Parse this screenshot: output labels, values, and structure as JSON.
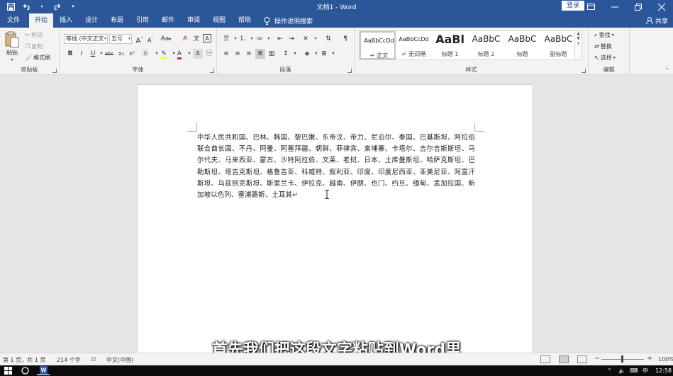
{
  "titlebar": {
    "title": "文档1 - Word",
    "login": "登录",
    "qat_icons": [
      "save-icon",
      "undo-icon",
      "redo-icon",
      "customize-qat-icon"
    ],
    "window_icons": [
      "ribbon-display-icon",
      "minimize-icon",
      "restore-icon",
      "close-icon"
    ]
  },
  "tabs": [
    "文件",
    "开始",
    "插入",
    "设计",
    "布局",
    "引用",
    "邮件",
    "审阅",
    "视图",
    "帮助"
  ],
  "active_tab": "开始",
  "tellme": "操作说明搜索",
  "share": "共享",
  "clipboard": {
    "paste": "粘贴",
    "cut": "剪切",
    "copy": "复制",
    "format_painter": "格式刷",
    "label": "剪贴板"
  },
  "font": {
    "font_name": "等线 (中文正文",
    "font_size": "五号",
    "label": "字体",
    "buttons": {
      "grow": "A",
      "shrink": "A",
      "case": "Aa",
      "bold": "B",
      "italic": "I",
      "underline": "U",
      "strike": "abc",
      "subscript": "x₂",
      "superscript": "x²",
      "font_color": "A"
    }
  },
  "paragraph": {
    "label": "段落"
  },
  "styles": {
    "label": "样式",
    "items": [
      {
        "preview": "AaBbCcDd",
        "name": "正文"
      },
      {
        "preview": "AaBbCcDd",
        "name": "无间隔"
      },
      {
        "preview": "AaBl",
        "name": "标题 1"
      },
      {
        "preview": "AaBbC",
        "name": "标题 2"
      },
      {
        "preview": "AaBbC",
        "name": "标题"
      },
      {
        "preview": "AaBbC",
        "name": "副标题"
      }
    ]
  },
  "editing": {
    "label": "编辑",
    "find": "查找",
    "replace": "替换",
    "select": "选择"
  },
  "document": {
    "text": "中华人民共和国、巴林、韩国、黎巴嫩、东帝汶、帝力、尼泊尔、泰国、巴基斯坦、阿拉伯联合酋长国、不丹、阿曼、阿塞拜疆、朝鲜、菲律宾、柬埔寨、卡塔尔、吉尔吉斯斯坦、马尔代夫、马来西亚、蒙古、沙特阿拉伯、文莱、老挝、日本、土库曼斯坦、哈萨克斯坦、巴勒斯坦、塔吉克斯坦、格鲁吉亚、科威特、叙利亚、印度、印度尼西亚、亚美尼亚、阿富汗斯坦、乌兹别克斯坦、斯里兰卡、伊拉克、越南、伊朗、也门、约旦、缅甸、孟加拉国、新加坡以色列、塞浦路斯、土耳其↵"
  },
  "subtitle": "首先我们把这段文字粘贴到Word里",
  "status": {
    "page": "第 1 页，共 1 页",
    "words": "214 个字",
    "language": "中文(中国)",
    "zoom": "100%"
  },
  "taskbar": {
    "ime": "中",
    "time": "12:58"
  }
}
